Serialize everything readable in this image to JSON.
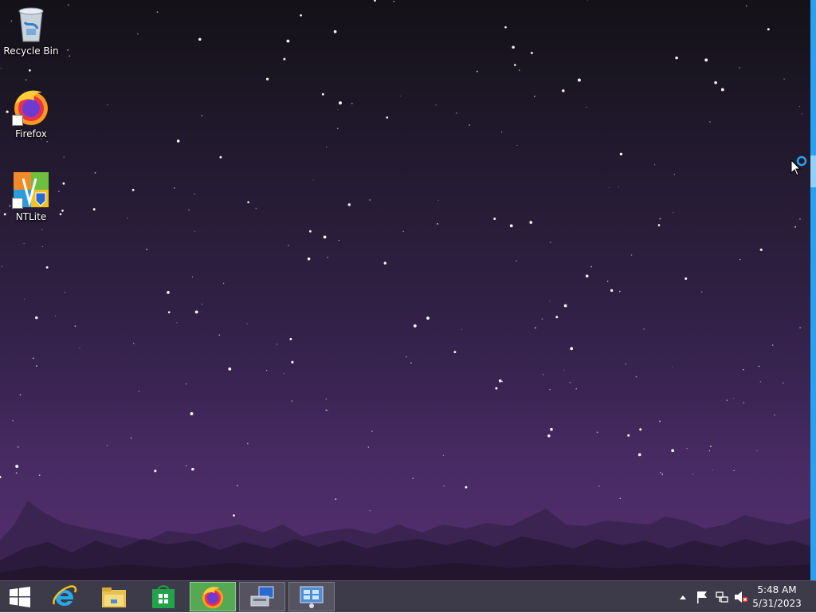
{
  "desktop": {
    "wallpaper": "purple starry night sky with mountain silhouettes",
    "icons": [
      {
        "label": "Recycle Bin",
        "icon": "recycle-bin-icon"
      },
      {
        "label": "Firefox",
        "icon": "firefox-icon",
        "shortcut": true
      },
      {
        "label": "NTLite",
        "icon": "ntlite-icon",
        "shortcut": true
      }
    ]
  },
  "taskbar": {
    "start_icon": "windows-logo-icon",
    "pinned": [
      {
        "icon": "internet-explorer-icon",
        "state": "pinned"
      },
      {
        "icon": "file-explorer-icon",
        "state": "pinned"
      },
      {
        "icon": "store-icon",
        "state": "pinned"
      },
      {
        "icon": "firefox-icon",
        "state": "active"
      },
      {
        "icon": "device-manager-icon",
        "state": "open"
      },
      {
        "icon": "control-panel-icon",
        "state": "open"
      }
    ],
    "tray": {
      "icons": [
        "show-hidden-icons-chevron",
        "action-center-flag-icon",
        "network-icon",
        "volume-muted-icon"
      ],
      "time": "5:48 AM",
      "date": "5/31/2023"
    }
  },
  "colors": {
    "taskbar": "#3d3a4a",
    "charm_edge": "#2ba0f0",
    "active_task": "#57a852"
  }
}
